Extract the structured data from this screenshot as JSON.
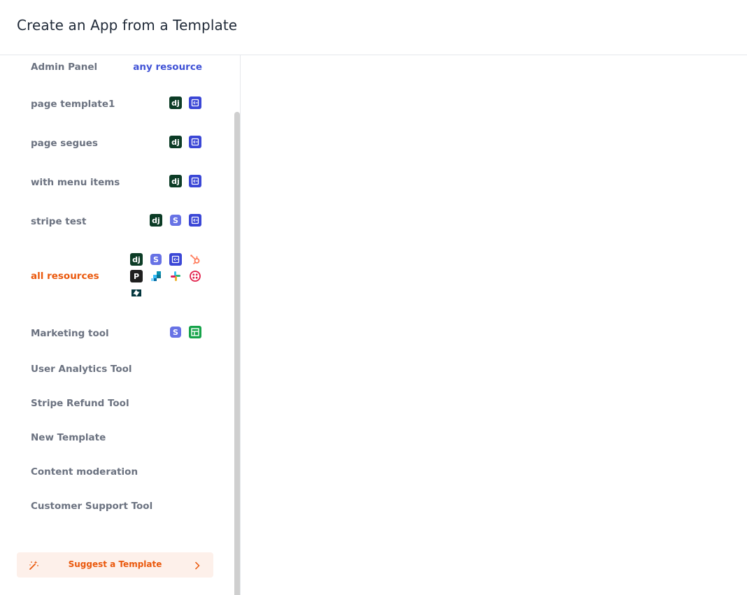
{
  "header": {
    "title": "Create an App from a Template"
  },
  "templates": [
    {
      "label": "Admin Panel",
      "right_text": "any resource"
    },
    {
      "label": "page template1"
    },
    {
      "label": "page segues"
    },
    {
      "label": "with menu items"
    },
    {
      "label": "stripe test"
    },
    {
      "label": "all resources"
    },
    {
      "label": "Marketing tool"
    },
    {
      "label": "User Analytics Tool"
    },
    {
      "label": "Stripe Refund Tool"
    },
    {
      "label": "New Template"
    },
    {
      "label": "Content moderation"
    },
    {
      "label": "Customer Support Tool"
    }
  ],
  "icon_glyphs": {
    "django": "dj",
    "stripe": "S",
    "p": "P"
  },
  "suggest": {
    "label": "Suggest a Template"
  },
  "colors": {
    "active": "#ea580c",
    "link": "#4052d6",
    "django": "#0c3c26",
    "rest": "#3b47d6",
    "stripe": "#6772e5",
    "sheets": "#16a34a",
    "suggest_bg": "#fdf0ea"
  }
}
